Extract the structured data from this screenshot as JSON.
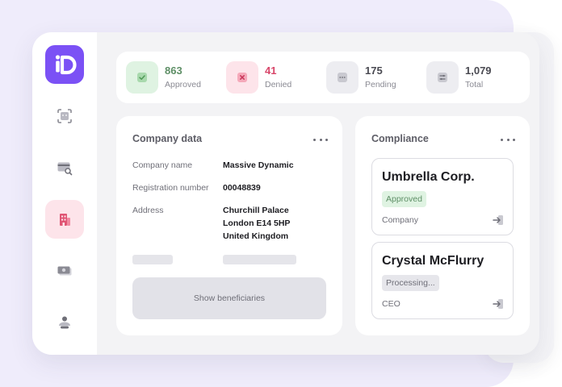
{
  "logo": {
    "text": "iD",
    "color": "#7b51f5"
  },
  "sidebar": {
    "items": [
      {
        "icon": "face-scan-icon",
        "active": false
      },
      {
        "icon": "id-card-search-icon",
        "active": false
      },
      {
        "icon": "building-icon",
        "active": true
      },
      {
        "icon": "money-icon",
        "active": false
      },
      {
        "icon": "users-icon",
        "active": false
      }
    ]
  },
  "stats": [
    {
      "value": "863",
      "label": "Approved",
      "icon": "check-icon",
      "color": "#dff3e2",
      "accent": "#6fbf73"
    },
    {
      "value": "41",
      "label": "Denied",
      "icon": "x-icon",
      "color": "#fde4ea",
      "accent": "#e05574"
    },
    {
      "value": "175",
      "label": "Pending",
      "icon": "ellipsis-icon",
      "color": "#ededf1",
      "accent": "#8a8a93"
    },
    {
      "value": "1,079",
      "label": "Total",
      "icon": "list-icon",
      "color": "#ededf1",
      "accent": "#8a8a93"
    }
  ],
  "company": {
    "title": "Company data",
    "fields": [
      {
        "label": "Company name",
        "value": "Massive Dynamic"
      },
      {
        "label": "Registration number",
        "value": "00048839"
      },
      {
        "label": "Address",
        "lines": [
          "Churchill Palace",
          "London E14 5HP",
          "United Kingdom"
        ]
      }
    ],
    "button": "Show beneficiaries"
  },
  "compliance": {
    "title": "Compliance",
    "entries": [
      {
        "name": "Umbrella Corp.",
        "status": "Approved",
        "role": "Company"
      },
      {
        "name": "Crystal McFlurry",
        "status": "Processing...",
        "role": "CEO"
      }
    ]
  }
}
